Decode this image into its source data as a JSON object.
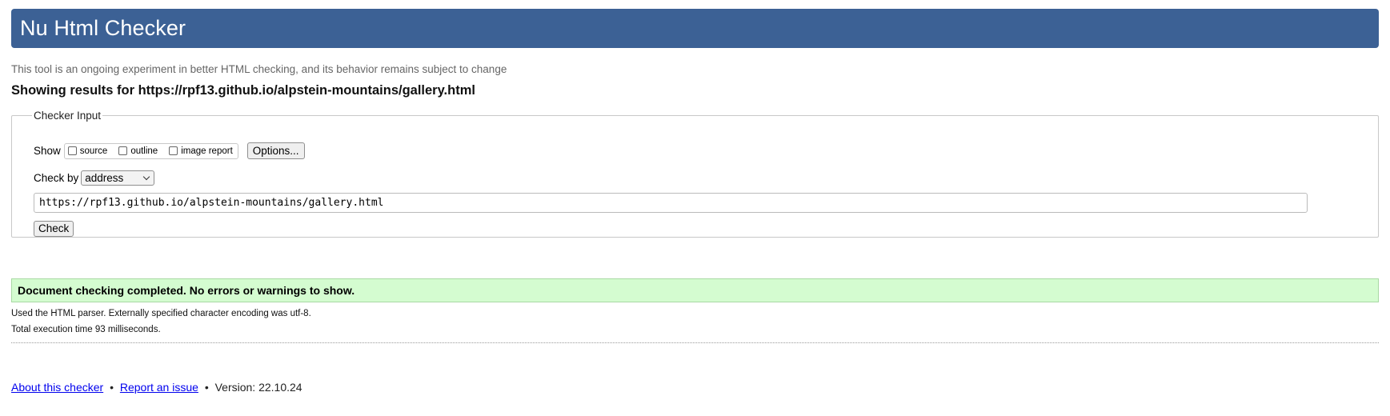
{
  "header": {
    "title": "Nu Html Checker"
  },
  "subtitle": "This tool is an ongoing experiment in better HTML checking, and its behavior remains subject to change",
  "results_heading": "Showing results for https://rpf13.github.io/alpstein-mountains/gallery.html",
  "checker_input": {
    "legend": "Checker Input",
    "show_label": "Show",
    "checkboxes": [
      {
        "label": "source",
        "checked": false
      },
      {
        "label": "outline",
        "checked": false
      },
      {
        "label": "image report",
        "checked": false
      }
    ],
    "options_label": "Options...",
    "check_by_label": "Check by",
    "check_by_selected": "address",
    "url_value": "https://rpf13.github.io/alpstein-mountains/gallery.html",
    "check_label": "Check"
  },
  "result": {
    "message": "Document checking completed. No errors or warnings to show.",
    "parser_note": "Used the HTML parser. Externally specified character encoding was utf-8.",
    "execution_time": "Total execution time 93 milliseconds."
  },
  "footer": {
    "about_link": "About this checker",
    "bullet1": "•",
    "report_link": "Report an issue",
    "bullet2": "•",
    "version": "Version: 22.10.24"
  },
  "colors": {
    "header_bg": "#3c6195",
    "success_bg": "#d4fcd0",
    "link": "#0000ee"
  }
}
